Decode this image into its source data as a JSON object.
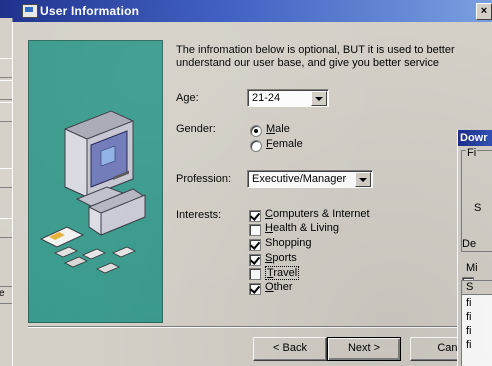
{
  "window": {
    "title": "User Information",
    "close_glyph": "×"
  },
  "form": {
    "intro": "The infromation below is optional, BUT it is used to better understand our user base, and give you better service",
    "age": {
      "label": "Age:",
      "value": "21-24"
    },
    "gender": {
      "label": "Gender:",
      "options": [
        {
          "label": "Male",
          "accel": "M",
          "rest": "ale",
          "selected": true
        },
        {
          "label": "Female",
          "accel": "F",
          "rest": "emale",
          "selected": false
        }
      ]
    },
    "profession": {
      "label": "Profession:",
      "value": "Executive/Manager"
    },
    "interests": {
      "label": "Interests:",
      "items": [
        {
          "label": "Computers & Internet",
          "accel": "C",
          "rest": "omputers & Internet",
          "checked": true
        },
        {
          "label": "Health  & Living",
          "accel": "H",
          "rest": "ealth  & Living",
          "checked": false
        },
        {
          "label": "Shopping",
          "accel": "",
          "rest": "Shopping",
          "checked": true
        },
        {
          "label": "Sports",
          "accel": "S",
          "rest": "ports",
          "checked": true
        },
        {
          "label": "Travel",
          "accel": "T",
          "rest": "ravel",
          "checked": false
        },
        {
          "label": "Other",
          "accel": "O",
          "rest": "ther",
          "checked": true
        }
      ]
    }
  },
  "buttons": {
    "back": "< Back",
    "next": "Next >",
    "cancel": "Canc"
  },
  "background_window": {
    "title": "Dowr",
    "group1": "Fi",
    "row_s": "S",
    "row_de": "De",
    "group2": "Mi",
    "list_header": "S",
    "list_rows": [
      "fi",
      "fi",
      "fi",
      "fi"
    ]
  },
  "left_window": {
    "cut_label": "ce"
  },
  "colors": {
    "title_bar": "#1a2e8a",
    "illustration_bg": "#3a9b8d",
    "dialog_face": "#d4d0c8"
  }
}
